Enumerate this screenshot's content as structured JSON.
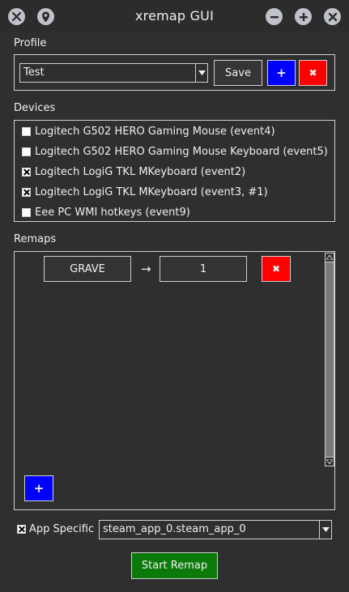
{
  "window": {
    "title": "xremap GUI",
    "buttons": {
      "left": [
        "xremap-logo-icon",
        "location-pin-icon"
      ],
      "right": [
        "minimize-icon",
        "maximize-icon",
        "close-icon"
      ]
    }
  },
  "profile": {
    "label": "Profile",
    "selected": "Test",
    "save_label": "Save",
    "add_label": "+",
    "delete_label": "✖"
  },
  "devices": {
    "label": "Devices",
    "items": [
      {
        "label": "Logitech G502 HERO Gaming Mouse (event4)",
        "checked": false
      },
      {
        "label": "Logitech G502 HERO Gaming Mouse Keyboard (event5)",
        "checked": false
      },
      {
        "label": "Logitech LogiG TKL MKeyboard (event2)",
        "checked": true
      },
      {
        "label": "Logitech LogiG TKL MKeyboard (event3, #1)",
        "checked": true
      },
      {
        "label": "Eee PC WMI hotkeys (event9)",
        "checked": false
      }
    ]
  },
  "remaps": {
    "label": "Remaps",
    "rows": [
      {
        "from": "GRAVE",
        "arrow": "→",
        "to": "1",
        "delete_label": "✖"
      }
    ],
    "add_label": "+"
  },
  "app_specific": {
    "label": "App Specific",
    "checked": true,
    "value": "steam_app_0.steam_app_0"
  },
  "start_label": "Start Remap",
  "colors": {
    "background": "#2f2f2f",
    "blue_button": "#0000ff",
    "red_button": "#ff0000",
    "green_button": "#0b7a0b"
  }
}
